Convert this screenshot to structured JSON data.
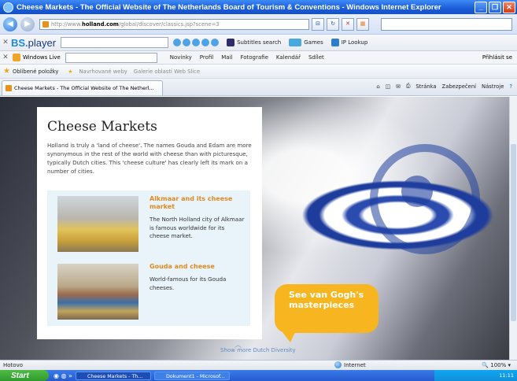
{
  "window": {
    "title": "Cheese Markets - The Official Website of The Netherlands Board of Tourism & Conventions - Windows Internet Explorer"
  },
  "address": {
    "url_prefix": "http://www.",
    "url_domain": "holland.com",
    "url_path": "/global/discover/classics.jsp?scene=3"
  },
  "toolbar_bs": {
    "logo_a": "BS.",
    "logo_b": "player",
    "subtitles": "Subtitles search",
    "games": "Games",
    "iplookup": "IP Lookup"
  },
  "toolbar_wl": {
    "brand": "Windows Live",
    "links": [
      "Novinky",
      "Profil",
      "Mail",
      "Fotografie",
      "Kalendář",
      "Sdílet"
    ],
    "signin": "Přihlásit se"
  },
  "favorites": {
    "label": "Oblíbené položky",
    "suggested": "Navrhované weby",
    "gallery": "Galerie oblastí Web Slice"
  },
  "tab": {
    "title": "Cheese Markets - The Official Website of The Netherl..."
  },
  "commands": {
    "page": "Stránka",
    "security": "Zabezpečení",
    "tools": "Nástroje"
  },
  "page": {
    "heading": "Cheese Markets",
    "intro": "Holland is truly a 'land of cheese'. The names Gouda and Edam are more synonymous in the rest of the world with cheese than with picturesque, typically Dutch cities. This 'cheese culture' has clearly left its mark on a number of cities.",
    "items": [
      {
        "title": "Alkmaar and its cheese market",
        "text": "The North Holland city of Alkmaar is famous worldwide for its cheese market."
      },
      {
        "title": "Gouda and cheese",
        "text": "World-famous for its Gouda cheeses."
      }
    ],
    "cta": "See van Gogh's masterpieces",
    "show_more": "Show more Dutch Diversity"
  },
  "status": {
    "left": "Hotovo",
    "zone": "Internet",
    "zoom": "100%"
  },
  "taskbar": {
    "start": "Start",
    "tasks": [
      "Cheese Markets - Th...",
      "Dokument1 - Microsof..."
    ],
    "clock": "11:11"
  }
}
